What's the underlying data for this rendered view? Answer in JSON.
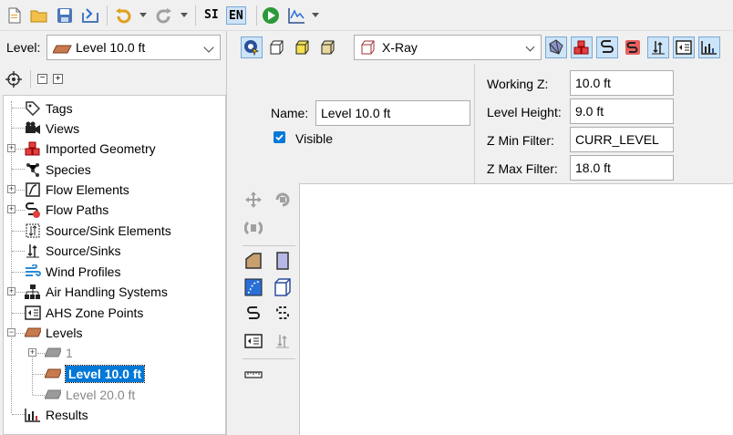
{
  "toolbar": {
    "si_label": "SI",
    "en_label": "EN"
  },
  "left": {
    "level_label": "Level:",
    "level_value": "Level 10.0 ft",
    "tree": [
      {
        "label": "Tags"
      },
      {
        "label": "Views"
      },
      {
        "label": "Imported Geometry"
      },
      {
        "label": "Species"
      },
      {
        "label": "Flow Elements"
      },
      {
        "label": "Flow Paths"
      },
      {
        "label": "Source/Sink Elements"
      },
      {
        "label": "Source/Sinks"
      },
      {
        "label": "Wind Profiles"
      },
      {
        "label": "Air Handling Systems"
      },
      {
        "label": "AHS Zone Points"
      },
      {
        "label": "Levels"
      },
      {
        "label": "1"
      },
      {
        "label": "Level 10.0 ft"
      },
      {
        "label": "Level 20.0 ft"
      },
      {
        "label": "Results"
      }
    ]
  },
  "right": {
    "view_mode": "X-Ray",
    "name_label": "Name:",
    "name_value": "Level 10.0 ft",
    "visible_label": "Visible",
    "visible_checked": true,
    "working_z_label": "Working Z:",
    "working_z_value": "10.0 ft",
    "level_height_label": "Level Height:",
    "level_height_value": "9.0 ft",
    "zmin_label": "Z Min Filter:",
    "zmin_value": "CURR_LEVEL",
    "zmax_label": "Z Max Filter:",
    "zmax_value": "18.0 ft"
  },
  "colors": {
    "selection": "#0078d7",
    "level_icon": "#c87a4f",
    "accent_blue": "#2a6fd6"
  }
}
